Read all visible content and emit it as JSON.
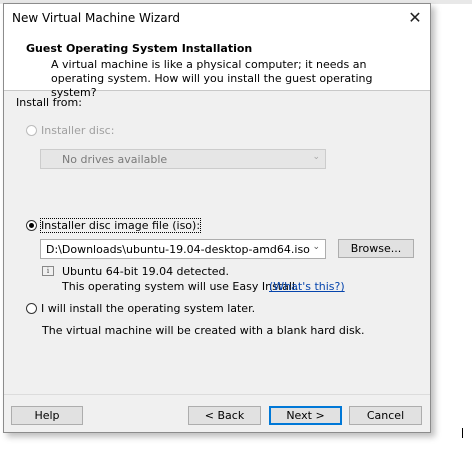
{
  "window": {
    "title": "New Virtual Machine Wizard"
  },
  "header": {
    "title": "Guest Operating System Installation",
    "description": "A virtual machine is like a physical computer; it needs an operating system. How will you install the guest operating system?"
  },
  "install_from": {
    "label": "Install from:",
    "options": [
      {
        "label": "Installer disc:",
        "selected": false,
        "enabled": false,
        "drive_select": {
          "value": "No drives available",
          "enabled": false
        }
      },
      {
        "label": "Installer disc image file (iso):",
        "selected": true,
        "enabled": true,
        "path_value": "D:\\Downloads\\ubuntu-19.04-desktop-amd64.iso",
        "browse_label": "Browse...",
        "detected_text": "Ubuntu 64-bit 19.04 detected.",
        "easy_install_text": "This operating system will use Easy Install.",
        "whats_this_link": "(What's this?)"
      },
      {
        "label": "I will install the operating system later.",
        "selected": false,
        "enabled": true,
        "note": "The virtual machine will be created with a blank hard disk."
      }
    ]
  },
  "buttons": {
    "help": "Help",
    "back": "< Back",
    "next": "Next >",
    "cancel": "Cancel"
  },
  "icons": {
    "close": "close-icon",
    "dropdown": "chevron-down-icon",
    "info": "info-icon"
  },
  "colors": {
    "default_button_border": "#0078d7",
    "link": "#0645ad",
    "dialog_bg": "#f0f0f0"
  }
}
